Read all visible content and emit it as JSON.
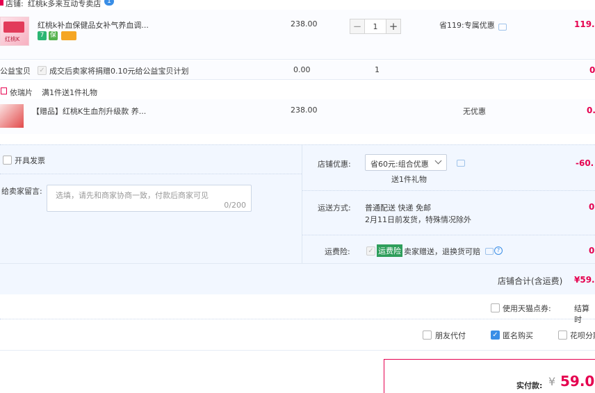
{
  "shop": {
    "label": "店铺:",
    "name": "红桃k多来互动专卖店",
    "msg_badge": "1"
  },
  "item1": {
    "thumb_text": "红桃K",
    "title": "红桃k补血保健品女补气养血调...",
    "badges": [
      "7",
      "保",
      "卡"
    ],
    "price": "238.00",
    "qty": "1",
    "discount": "省119:专属优惠",
    "subtotal": "119."
  },
  "charity": {
    "label": "公益宝贝",
    "text": "成交后卖家将捐赠0.10元给公益宝贝计划",
    "price": "0.00",
    "qty": "1",
    "subtotal": "0"
  },
  "gift": {
    "brand": "依瑞片",
    "promo": "满1件送1件礼物",
    "title": "【赠品】红桃K生血剂升级款 养...",
    "price": "238.00",
    "discount": "无优惠",
    "subtotal": "0."
  },
  "invoice": {
    "label": "开具发票"
  },
  "message": {
    "label": "给卖家留言:",
    "placeholder": "选填，请先和商家协商一致，付款后商家可见",
    "counter": "0/200"
  },
  "shop_discount": {
    "label": "店铺优惠:",
    "selected": "省60元:组合优惠",
    "gift_note": "送1件礼物",
    "amount": "-60."
  },
  "shipping": {
    "label": "运送方式:",
    "method": "普通配送 快递 免邮",
    "note": "2月11日前发货，特殊情况除外",
    "amount": "0"
  },
  "insurance": {
    "label": "运费险:",
    "tag": "运费险",
    "text": "卖家赠送，退换货可赔",
    "amount": "0"
  },
  "shop_total": {
    "label": "店铺合计(含运费)",
    "amount": "¥59."
  },
  "tmall_points": {
    "label": "使用天猫点券:",
    "right": "结算时"
  },
  "options": {
    "friend_pay": "朋友代付",
    "anonymous": "匿名购买",
    "huabei": "花呗分期"
  },
  "payment": {
    "label": "实付款:",
    "currency": "¥",
    "amount": "59.0"
  },
  "colors": {
    "accent": "#e5004f",
    "link_blue": "#3a8ee6",
    "panel_bg": "#f2f7ff"
  }
}
